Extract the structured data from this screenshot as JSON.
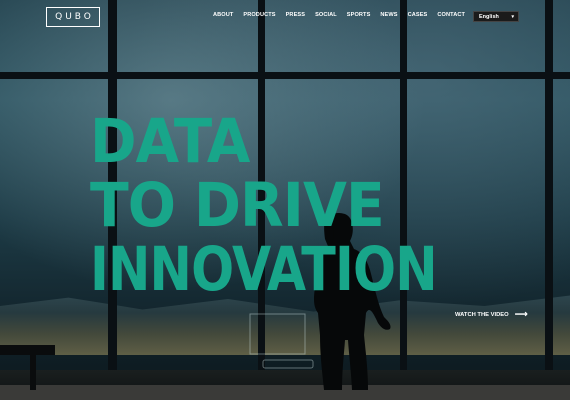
{
  "brand": {
    "logo_text": "QUBO"
  },
  "nav": {
    "items": [
      {
        "label": "ABOUT"
      },
      {
        "label": "PRODUCTS"
      },
      {
        "label": "PRESS"
      },
      {
        "label": "SOCIAL"
      },
      {
        "label": "SPORTS"
      },
      {
        "label": "NEWS"
      },
      {
        "label": "CASES"
      },
      {
        "label": "CONTACT"
      }
    ]
  },
  "language_select": {
    "value": "English",
    "icon": "caret-down-icon"
  },
  "hero": {
    "headline_line1": "DATA",
    "headline_line2": "TO DRIVE",
    "headline_line3": "INNOVATION",
    "headline_color": "#18a68a",
    "cta_label": "WATCH THE VIDEO",
    "cta_icon": "arrow-right-icon"
  }
}
